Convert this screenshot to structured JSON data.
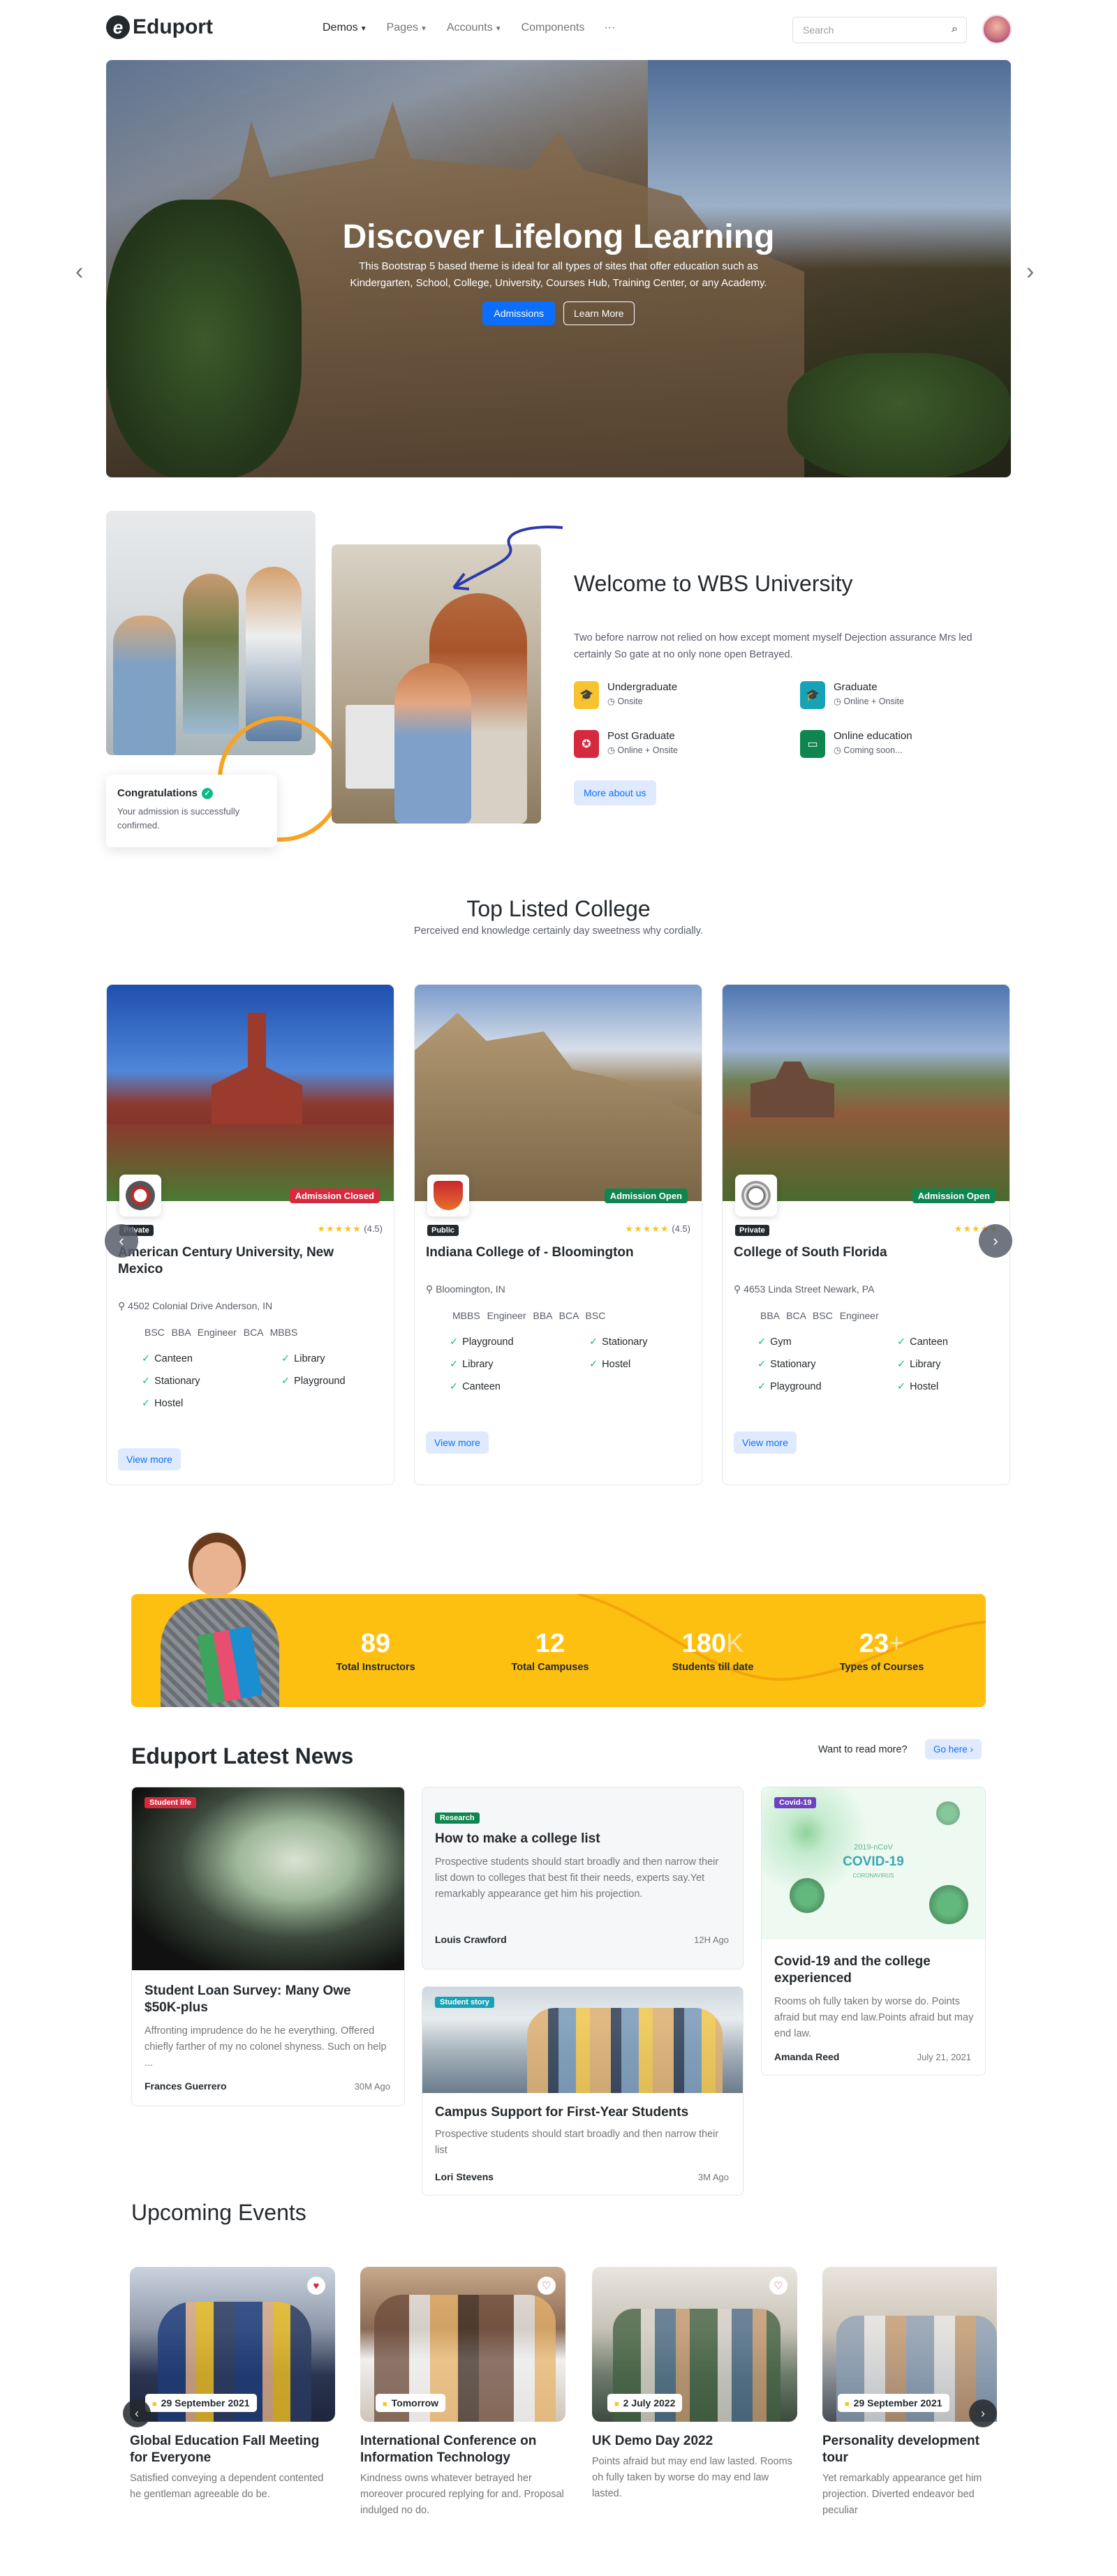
{
  "header": {
    "brand": "Eduport",
    "menu": [
      "Demos",
      "Pages",
      "Accounts",
      "Components"
    ],
    "more": "···",
    "search_placeholder": "Search"
  },
  "hero": {
    "title": "Discover Lifelong Learning",
    "text": "This Bootstrap 5 based theme is ideal for all types of sites that offer education such as Kindergarten, School, College, University, Courses Hub, Training Center, or any Academy.",
    "primary_btn": "Admissions",
    "secondary_btn": "Learn More"
  },
  "toast": {
    "title": "Congratulations",
    "text": "Your admission is successfully confirmed."
  },
  "welcome": {
    "title": "Welcome to WBS University",
    "text": "Two before narrow not relied on how except moment myself Dejection assurance Mrs led certainly So gate at no only none open Betrayed.",
    "features": [
      {
        "title": "Undergraduate",
        "sub": "Onsite",
        "color": "#f7c32e"
      },
      {
        "title": "Graduate",
        "sub": "Online + Onsite",
        "color": "#17a2b8"
      },
      {
        "title": "Post Graduate",
        "sub": "Online + Onsite",
        "color": "#d6293e"
      },
      {
        "title": "Online education",
        "sub": "Coming soon...",
        "color": "#0f8650"
      }
    ],
    "button": "More about us"
  },
  "colleges": {
    "title": "Top Listed College",
    "subtitle": "Perceived end knowledge certainly day sweetness why cordially.",
    "items": [
      {
        "name": "American Century University, New Mexico",
        "badge": "Admission Closed",
        "badge_color": "#d6293e",
        "type": "Private",
        "rating": "(4.5)",
        "stars": "★★★★★",
        "address": "4502 Colonial Drive Anderson, IN",
        "tags": "BSC  BBA  Engineer  BCA  MBBS",
        "facilities": [
          "Canteen",
          "Library",
          "Stationary",
          "Playground",
          "Hostel"
        ],
        "button": "View more"
      },
      {
        "name": "Indiana College of - Bloomington",
        "badge": "Admission Open",
        "badge_color": "#0f8650",
        "type": "Public",
        "rating": "(4.5)",
        "stars": "★★★★★",
        "address": "Bloomington, IN",
        "tags": "MBBS  Engineer  BBA  BCA  BSC",
        "facilities": [
          "Playground",
          "Stationary",
          "Library",
          "Hostel",
          "Canteen"
        ],
        "button": "View more"
      },
      {
        "name": "College of South Florida",
        "badge": "Admission Open",
        "badge_color": "#0f8650",
        "type": "Private",
        "rating": "",
        "stars": "★★★★★",
        "address": "4653 Linda Street Newark, PA",
        "tags": "BBA  BCA  BSC  Engineer",
        "facilities": [
          "Gym",
          "Canteen",
          "Stationary",
          "Library",
          "Playground",
          "Hostel"
        ],
        "button": "View more"
      }
    ]
  },
  "counters": [
    {
      "value": "89",
      "suffix": "",
      "label": "Total Instructors"
    },
    {
      "value": "12",
      "suffix": "",
      "label": "Total Campuses"
    },
    {
      "value": "180",
      "suffix": "K",
      "label": "Students till date"
    },
    {
      "value": "23",
      "suffix": "+",
      "label": "Types of Courses"
    }
  ],
  "news": {
    "title": "Eduport Latest News",
    "read_more": "Want to read more?",
    "go_here": "Go here",
    "items": [
      {
        "tag": "Student life",
        "title": "Student Loan Survey: Many Owe $50K-plus",
        "text": "Affronting imprudence do he he everything. Offered chiefly farther of my no colonel shyness. Such on help ...",
        "author": "Frances Guerrero",
        "time": "30M Ago"
      },
      {
        "tag": "Research",
        "title": "How to make a college list",
        "text": "Prospective students should start broadly and then narrow their list down to colleges that best fit their needs, experts say.Yet remarkably appearance get him his projection.",
        "author": "Louis Crawford",
        "time": "12H Ago"
      },
      {
        "tag": "Student story",
        "title": "Campus Support for First-Year Students",
        "text": "Prospective students should start broadly and then narrow their list",
        "author": "Lori Stevens",
        "time": "3M Ago"
      },
      {
        "tag": "Covid-19",
        "title": "Covid-19 and the college experienced",
        "text": "Rooms oh fully taken by worse do. Points afraid but may end law.Points afraid but may end law.",
        "author": "Amanda Reed",
        "time": "July 21, 2021",
        "img_text": "2019-nCoV",
        "img_title": "COVID-19",
        "img_sub": "CORONAVIRUS"
      }
    ]
  },
  "events": {
    "title": "Upcoming Events",
    "items": [
      {
        "date": "29 September 2021",
        "title": "Global Education Fall Meeting for Everyone",
        "text": "Satisfied conveying a dependent contented he gentleman agreeable do be."
      },
      {
        "date": "Tomorrow",
        "title": "International Conference on Information Technology",
        "text": "Kindness owns whatever betrayed her moreover procured replying for and. Proposal indulged no do."
      },
      {
        "date": "2 July 2022",
        "title": "UK Demo Day 2022",
        "text": "Points afraid but may end law lasted. Rooms oh fully taken by worse do may end law lasted."
      },
      {
        "date": "29 September 2021",
        "title": "Personality development tour",
        "text": "Yet remarkably appearance get him projection. Diverted endeavor bed peculiar"
      }
    ]
  }
}
